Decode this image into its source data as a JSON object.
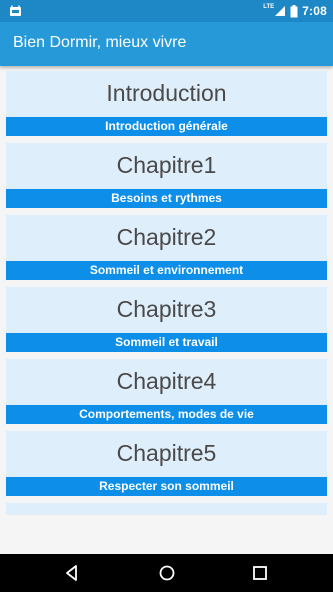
{
  "status_bar": {
    "network_label": "LTE",
    "time": "7:08",
    "icons": [
      "notification-icon",
      "signal-icon",
      "battery-icon"
    ]
  },
  "app_bar": {
    "title": "Bien Dormir, mieux vivre"
  },
  "chapters": [
    {
      "title": "Introduction",
      "subtitle": "Introduction générale"
    },
    {
      "title": "Chapitre1",
      "subtitle": "Besoins et rythmes"
    },
    {
      "title": "Chapitre2",
      "subtitle": "Sommeil et environnement"
    },
    {
      "title": "Chapitre3",
      "subtitle": "Sommeil et travail"
    },
    {
      "title": "Chapitre4",
      "subtitle": "Comportements, modes de vie"
    },
    {
      "title": "Chapitre5",
      "subtitle": "Respecter son sommeil"
    }
  ],
  "nav_bar": {
    "icons": [
      "back-icon",
      "home-icon",
      "recents-icon"
    ]
  },
  "colors": {
    "status_bar": "#1e88c7",
    "app_bar": "#2699d9",
    "card_background": "#deeefb",
    "subtitle_band": "#0d8ee8"
  }
}
